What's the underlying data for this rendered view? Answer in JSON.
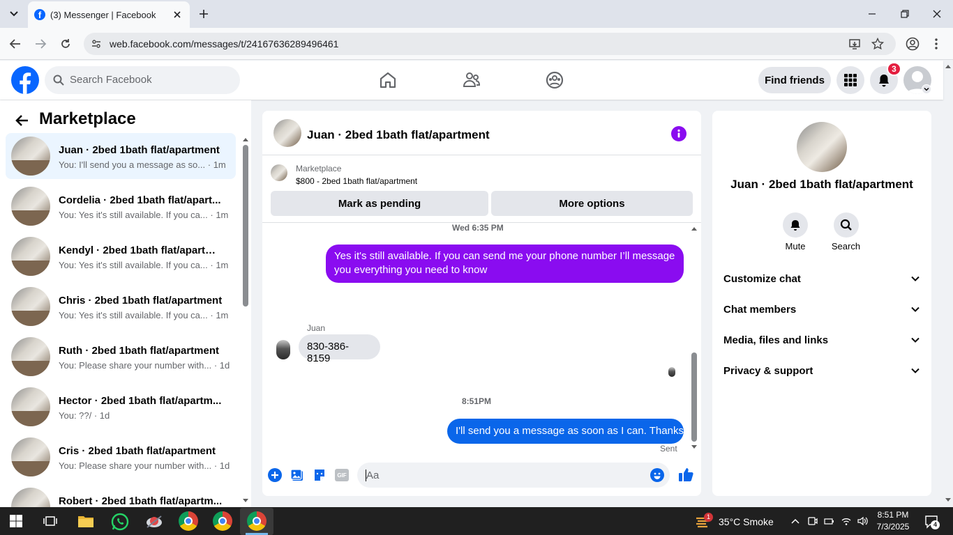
{
  "browser": {
    "tab_title": "(3) Messenger | Facebook",
    "url": "web.facebook.com/messages/t/24167636289496461"
  },
  "header": {
    "search_placeholder": "Search Facebook",
    "find_friends": "Find friends",
    "notification_count": "3"
  },
  "sidebar": {
    "title": "Marketplace",
    "conversations": [
      {
        "name": "Juan · 2bed 1bath flat/apartment",
        "preview": "You: I'll send you a message as so...",
        "time": "· 1m"
      },
      {
        "name": "Cordelia · 2bed 1bath flat/apart...",
        "preview": "You: Yes it's still available. If you ca...",
        "time": "· 1m"
      },
      {
        "name": "Kendyl · 2bed 1bath flat/apartm...",
        "preview": "You: Yes it's still available. If you ca...",
        "time": "· 1m"
      },
      {
        "name": "Chris · 2bed 1bath flat/apartment",
        "preview": "You: Yes it's still available. If you ca...",
        "time": "· 1m"
      },
      {
        "name": "Ruth · 2bed 1bath flat/apartment",
        "preview": "You: Please share your number with...",
        "time": "· 1d"
      },
      {
        "name": "Hector · 2bed 1bath flat/apartm...",
        "preview": "You: ??/",
        "time": "· 1d"
      },
      {
        "name": "Cris · 2bed 1bath flat/apartment",
        "preview": "You: Please share your number with...",
        "time": "· 1d"
      },
      {
        "name": "Robert · 2bed 1bath flat/apartm...",
        "preview": "",
        "time": ""
      }
    ]
  },
  "chat": {
    "title": "Juan · 2bed 1bath flat/apartment",
    "listing_source": "Marketplace",
    "listing_title": "$800 - 2bed 1bath flat/apartment",
    "mark_pending": "Mark as pending",
    "more_options": "More options",
    "time1": "Wed 6:35 PM",
    "msg1": "Yes it's still available. If you can send me your phone number I’ll message you everything you need to know",
    "sender_name": "Juan",
    "msg2": "830-386-8159",
    "time2": "8:51PM",
    "msg3": "I'll send you a message as soon as I can. Thanks",
    "status": "Sent",
    "input_placeholder": "Aa",
    "gif_label": "GIF"
  },
  "details": {
    "name": "Juan · 2bed 1bath flat/apartment",
    "mute": "Mute",
    "search": "Search",
    "options": [
      "Customize chat",
      "Chat members",
      "Media, files and links",
      "Privacy & support"
    ]
  },
  "taskbar": {
    "temperature": "35°C",
    "weather": "Smoke",
    "time": "8:51 PM",
    "date": "7/3/2025",
    "weather_badge": "1",
    "notif_count": "4"
  },
  "colors": {
    "messenger_purple": "#8a0cf0",
    "messenger_blue": "#0a66ea",
    "fb_blue": "#0866ff"
  }
}
